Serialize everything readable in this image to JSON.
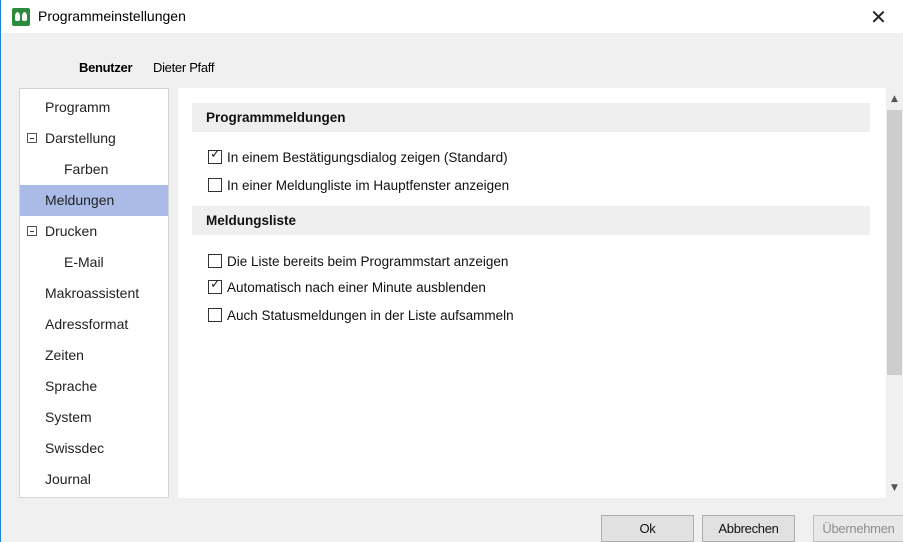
{
  "window": {
    "title": "Programmeinstellungen",
    "close_glyph": "✕",
    "app_icon": "users-icon"
  },
  "user": {
    "label": "Benutzer",
    "name": "Dieter Pfaff"
  },
  "nav": {
    "items": [
      {
        "label": "Programm",
        "level": 0,
        "expander": false,
        "selected": false
      },
      {
        "label": "Darstellung",
        "level": 0,
        "expander": true,
        "selected": false
      },
      {
        "label": "Farben",
        "level": 1,
        "expander": false,
        "selected": false
      },
      {
        "label": "Meldungen",
        "level": 0,
        "expander": false,
        "selected": true
      },
      {
        "label": "Drucken",
        "level": 0,
        "expander": true,
        "selected": false
      },
      {
        "label": "E-Mail",
        "level": 1,
        "expander": false,
        "selected": false
      },
      {
        "label": "Makroassistent",
        "level": 0,
        "expander": false,
        "selected": false
      },
      {
        "label": "Adressformat",
        "level": 0,
        "expander": false,
        "selected": false
      },
      {
        "label": "Zeiten",
        "level": 0,
        "expander": false,
        "selected": false
      },
      {
        "label": "Sprache",
        "level": 0,
        "expander": false,
        "selected": false
      },
      {
        "label": "System",
        "level": 0,
        "expander": false,
        "selected": false
      },
      {
        "label": "Swissdec",
        "level": 0,
        "expander": false,
        "selected": false
      },
      {
        "label": "Journal",
        "level": 0,
        "expander": false,
        "selected": false
      }
    ]
  },
  "content": {
    "sections": [
      {
        "title": "Programmmeldungen",
        "options": [
          {
            "label": "In einem Bestätigungsdialog zeigen (Standard)",
            "checked": true
          },
          {
            "label": "In einer Meldungliste im Hauptfenster anzeigen",
            "checked": false
          }
        ]
      },
      {
        "title": "Meldungsliste",
        "options": [
          {
            "label": "Die Liste bereits beim Programmstart anzeigen",
            "checked": false
          },
          {
            "label": "Automatisch nach einer Minute ausblenden",
            "checked": true
          },
          {
            "label": "Auch Statusmeldungen in der Liste aufsammeln",
            "checked": false
          }
        ]
      }
    ]
  },
  "buttons": {
    "ok": "Ok",
    "cancel": "Abbrechen",
    "apply": "Übernehmen"
  },
  "colors": {
    "selection": "#a9bbe6",
    "window_border": "#1883d7",
    "icon_green": "#2b8a3e"
  }
}
